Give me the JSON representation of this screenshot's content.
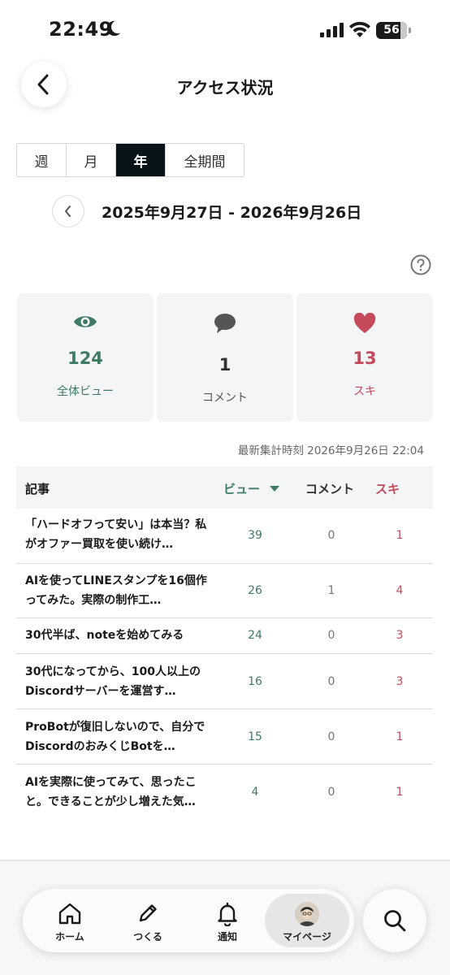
{
  "status_bar": {
    "time": "22:49",
    "battery": "56"
  },
  "header": {
    "title": "アクセス状況"
  },
  "period_tabs": [
    {
      "label": "週",
      "active": false
    },
    {
      "label": "月",
      "active": false
    },
    {
      "label": "年",
      "active": true
    },
    {
      "label": "全期間",
      "active": false
    }
  ],
  "date_range": "2025年9月27日 - 2026年9月26日",
  "stats": {
    "views": {
      "value": "124",
      "label": "全体ビュー",
      "color": "#3f7a63"
    },
    "comments": {
      "value": "1",
      "label": "コメント",
      "color": "#555555"
    },
    "likes": {
      "value": "13",
      "label": "スキ",
      "color": "#c54a5c"
    }
  },
  "updated_at": "最新集計時刻 2026年9月26日 22:04",
  "table": {
    "headers": {
      "article": "記事",
      "views": "ビュー",
      "comments": "コメント",
      "likes": "スキ"
    },
    "rows": [
      {
        "title": "「ハードオフって安い」は本当？私がオファー買取を使い続け…",
        "views": "39",
        "comments": "0",
        "likes": "1"
      },
      {
        "title": "AIを使ってLINEスタンプを16個作ってみた。実際の制作工…",
        "views": "26",
        "comments": "1",
        "likes": "4"
      },
      {
        "title": "30代半ば、noteを始めてみる",
        "views": "24",
        "comments": "0",
        "likes": "3"
      },
      {
        "title": "30代になってから、100人以上のDiscordサーバーを運営す…",
        "views": "16",
        "comments": "0",
        "likes": "3"
      },
      {
        "title": "ProBotが復旧しないので、自分でDiscordのおみくじBotを…",
        "views": "15",
        "comments": "0",
        "likes": "1"
      },
      {
        "title": "AIを実際に使ってみて、思ったこと。できることが少し増えた気…",
        "views": "4",
        "comments": "0",
        "likes": "1"
      }
    ]
  },
  "bottom_nav": {
    "items": [
      {
        "label": "ホーム",
        "icon": "home-icon"
      },
      {
        "label": "つくる",
        "icon": "pencil-icon"
      },
      {
        "label": "通知",
        "icon": "bell-icon"
      },
      {
        "label": "マイページ",
        "icon": "avatar",
        "active": true
      }
    ]
  },
  "colors": {
    "views": "#3f7a63",
    "likes": "#c54a5c",
    "active_tab": "#08131a"
  }
}
